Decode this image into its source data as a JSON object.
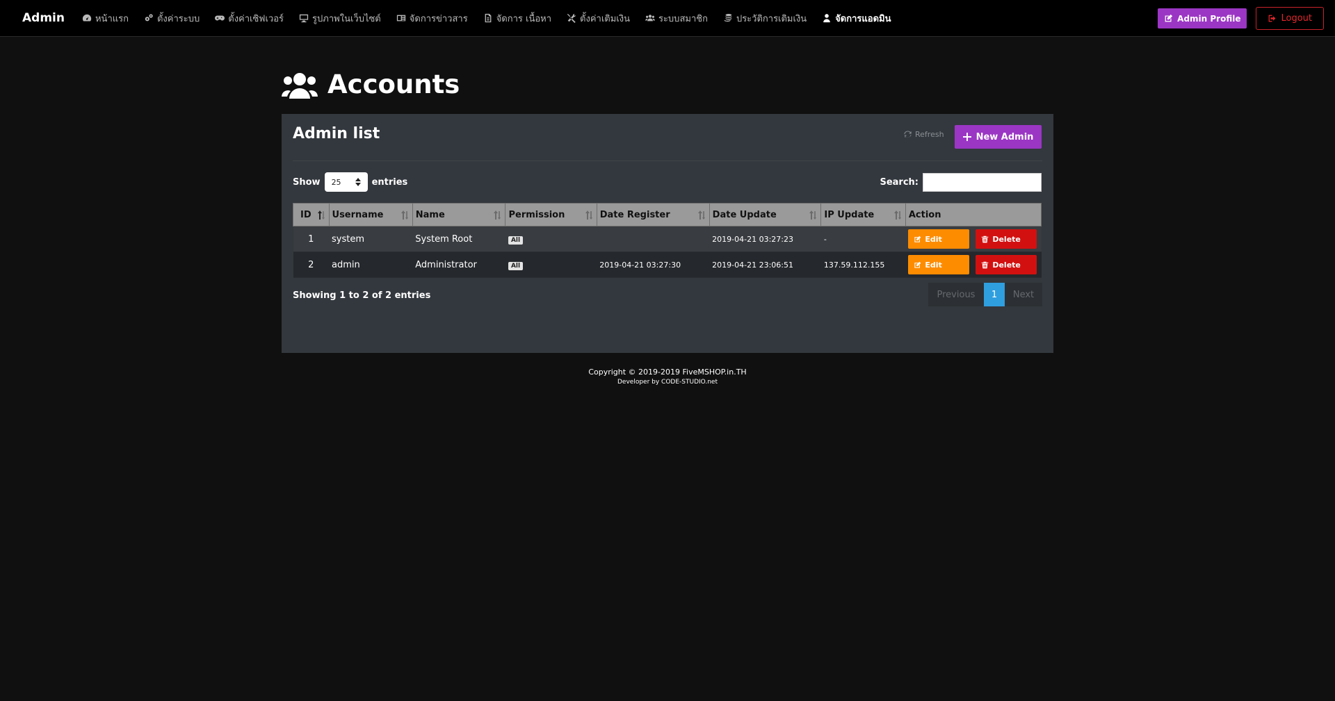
{
  "navbar": {
    "brand": "Admin",
    "items": [
      {
        "label": "หน้าแรก",
        "icon": "dashboard-icon"
      },
      {
        "label": "ตั้งค่าระบบ",
        "icon": "gears-icon"
      },
      {
        "label": "ตั้งค่าเซิฟเวอร์",
        "icon": "gamepad-icon"
      },
      {
        "label": "รูปภาพในเว็บไซต์",
        "icon": "desktop-icon"
      },
      {
        "label": "จัดการข่าวสาร",
        "icon": "newspaper-icon"
      },
      {
        "label": "จัดการ เนื้อหา",
        "icon": "file-icon"
      },
      {
        "label": "ตั้งค่าเติมเงิน",
        "icon": "tools-icon"
      },
      {
        "label": "ระบบสมาชิก",
        "icon": "users-icon"
      },
      {
        "label": "ประวัติการเติมเงิน",
        "icon": "coins-icon"
      },
      {
        "label": "จัดการแอดมิน",
        "icon": "user-icon"
      }
    ],
    "profile_label": "Admin Profile",
    "logout_label": "Logout"
  },
  "page": {
    "title": "Accounts"
  },
  "card": {
    "title": "Admin list",
    "refresh_label": "Refresh",
    "new_label": "New Admin"
  },
  "table_controls": {
    "show_label": "Show",
    "length_value": "25",
    "entries_label": "entries",
    "search_label": "Search:",
    "search_value": ""
  },
  "table": {
    "columns": [
      "ID",
      "Username",
      "Name",
      "Permission",
      "Date Register",
      "Date Update",
      "IP Update",
      "Action"
    ],
    "rows": [
      {
        "id": "1",
        "username": "system",
        "name": "System Root",
        "permission": "All",
        "date_register": "",
        "date_update": "2019-04-21 03:27:23",
        "ip_update": "-"
      },
      {
        "id": "2",
        "username": "admin",
        "name": "Administrator",
        "permission": "All",
        "date_register": "2019-04-21 03:27:30",
        "date_update": "2019-04-21 23:06:51",
        "ip_update": "137.59.112.155"
      }
    ],
    "edit_label": "Edit",
    "delete_label": "Delete"
  },
  "pagination": {
    "info": "Showing 1 to 2 of 2 entries",
    "previous_label": "Previous",
    "current_page": "1",
    "next_label": "Next"
  },
  "footer": {
    "copyright": "Copyright © 2019-2019 FiveMSHOP.in.TH",
    "developer": "Developer by CODE-STUDIO.net"
  },
  "colors": {
    "accent": "#9b36c4",
    "edit": "#fe8c00",
    "delete": "#d31010",
    "page_active": "#2f9fe0"
  }
}
